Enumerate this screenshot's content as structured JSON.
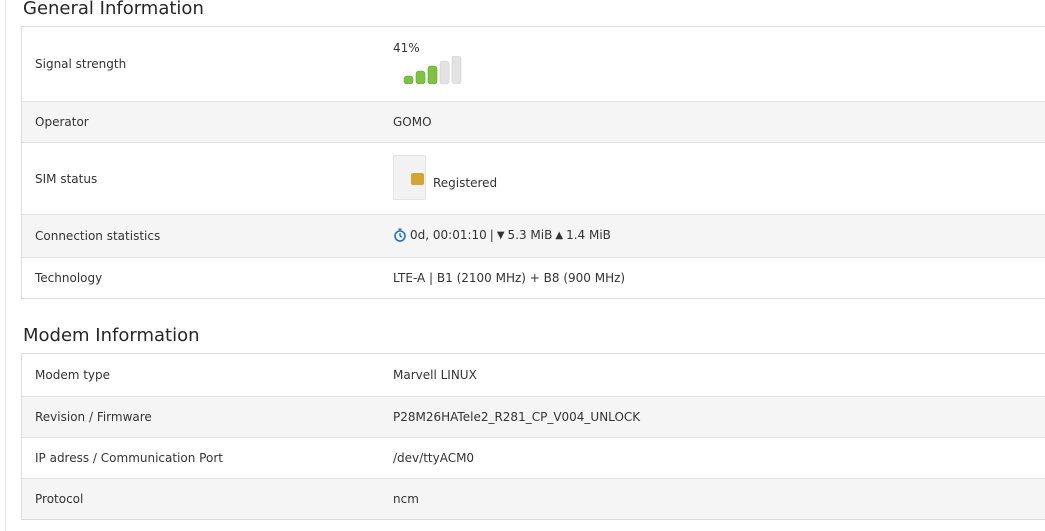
{
  "general": {
    "title": "General Information",
    "signal": {
      "label": "Signal strength",
      "percent_text": "41%",
      "level": 0.41,
      "bars_total": 5,
      "bars_active": 3
    },
    "operator": {
      "label": "Operator",
      "value": "GOMO"
    },
    "sim": {
      "label": "SIM status",
      "value": "Registered"
    },
    "connection": {
      "label": "Connection statistics",
      "uptime": "0d, 00:01:10",
      "sep": "|",
      "down_arrow": "▼",
      "down": "5.3 MiB",
      "up_arrow": "▲",
      "up": "1.4 MiB"
    },
    "technology": {
      "label": "Technology",
      "value": "LTE-A | B1 (2100 MHz) + B8 (900 MHz)"
    }
  },
  "modem": {
    "title": "Modem Information",
    "type": {
      "label": "Modem type",
      "value": "Marvell LINUX"
    },
    "firmware": {
      "label": "Revision / Firmware",
      "value": "P28M26HATele2_R281_CP_V004_UNLOCK"
    },
    "port": {
      "label": "IP adress / Communication Port",
      "value": "/dev/ttyACM0"
    },
    "protocol": {
      "label": "Protocol",
      "value": "ncm"
    }
  },
  "colors": {
    "signal_active": "#7dc242",
    "signal_inactive": "#e3e3e3",
    "sim_chip": "#d6a531",
    "timer_icon": "#1f74c4"
  },
  "icons": {
    "signal": "signal-bars-icon",
    "sim": "sim-card-icon",
    "timer": "stopwatch-icon"
  }
}
